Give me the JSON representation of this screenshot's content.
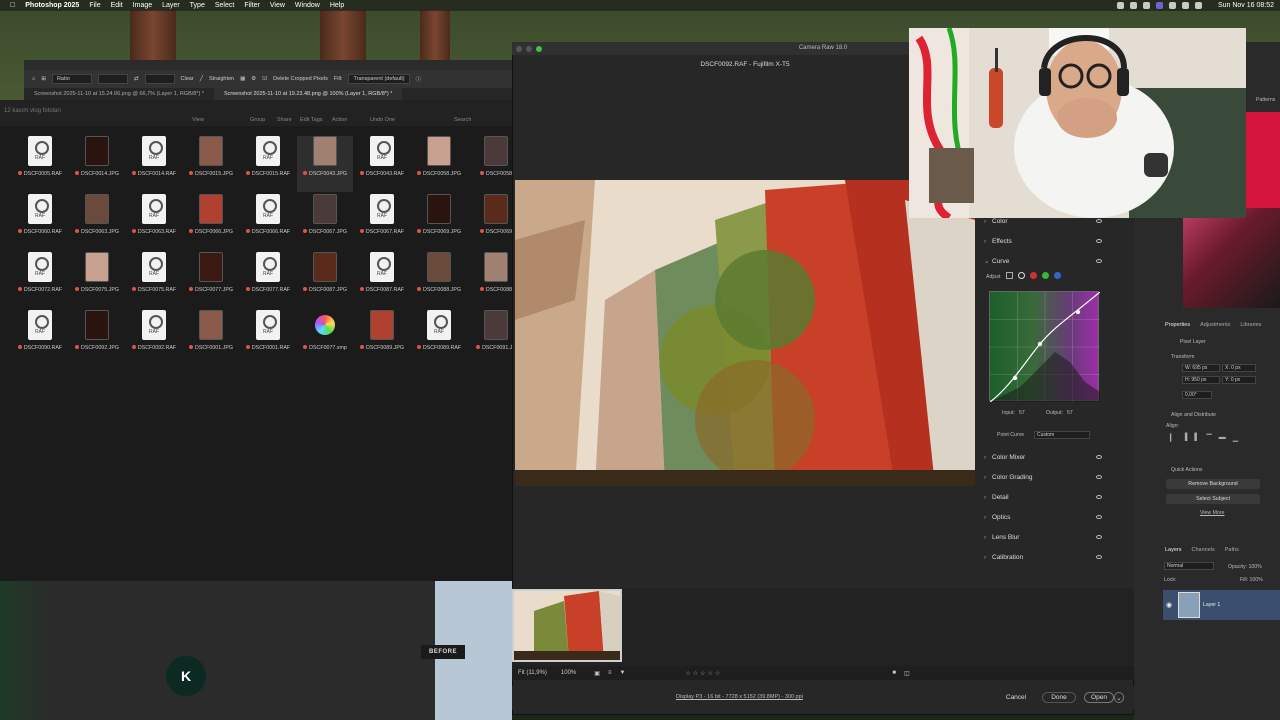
{
  "menubar": {
    "app": "Photoshop 2025",
    "items": [
      "File",
      "Edit",
      "Image",
      "Layer",
      "Type",
      "Select",
      "Filter",
      "View",
      "Window",
      "Help"
    ],
    "clock": "Sun Nov 16  08:52"
  },
  "ps_options": {
    "ratio": "Ratio",
    "clear": "Clear",
    "straighten": "Straighten",
    "delete_cropped": "Delete Cropped Pixels",
    "fill_label": "Fill:",
    "fill_value": "Transparent (default)"
  },
  "ps_tabs": [
    "Screenshot 2025-11-10 at 15.24.06.png @ 66,7% (Layer 1, RGB/8*) *",
    "Screenshot 2025-11-10 at 19.23.48.png @ 100% (Layer 1, RGB/8*) *"
  ],
  "bridge": {
    "folder": "12 kasım vlog fotoları",
    "toolbar": [
      "View",
      "Group",
      "Share",
      "Edit Tags",
      "Action",
      "Undo One",
      "Search"
    ],
    "rows": [
      [
        "DSCF0005.RAF",
        "DSCF0014.JPG",
        "DSCF0014.RAF",
        "DSCF0015.JPG",
        "DSCF0015.RAF",
        "DSCF0043.JPG",
        "DSCF0043.RAF",
        "DSCF0058.JPG",
        "DSCF0058"
      ],
      [
        "DSCF0060.RAF",
        "DSCF0063.JPG",
        "DSCF0063.RAF",
        "DSCF0066.JPG",
        "DSCF0066.RAF",
        "DSCF0067.JPG",
        "DSCF0067.RAF",
        "DSCF0069.JPG",
        "DSCF0069"
      ],
      [
        "DSCF0072.RAF",
        "DSCF0075.JPG",
        "DSCF0075.RAF",
        "DSCF0077.JPG",
        "DSCF0077.RAF",
        "DSCF0087.JPG",
        "DSCF0087.RAF",
        "DSCF0088.JPG",
        "DSCF0088"
      ],
      [
        "DSCF0090.RAF",
        "DSCF0092.JPG",
        "DSCF0092.RAF",
        "DSCF0001.JPG",
        "DSCF0001.RAF",
        "DSCF0077.xmp",
        "DSCF0089.JPG",
        "DSCF0089.RAF",
        "DSCF0091.JP"
      ]
    ],
    "raf_label": "RAF"
  },
  "before_label": "BEFORE",
  "badge_letter": "K",
  "camera_raw": {
    "title": "Camera Raw 18.0",
    "file": "DSCF0092.RAF  -  Fujifilm X-T5",
    "panel": {
      "color": "Color",
      "effects": "Effects",
      "curve": "Curve",
      "adjust": "Adjust",
      "input_label": "Input:",
      "input_value": "57",
      "output_label": "Output:",
      "output_value": "57",
      "point_curve_label": "Point Curve",
      "point_curve_value": "Custom",
      "sections": [
        "Color Mixer",
        "Color Grading",
        "Detail",
        "Optics",
        "Lens Blur",
        "Calibration"
      ]
    },
    "status": {
      "fit": "Fit (11,9%)",
      "zoom": "100%",
      "info": "Display P3 - 16 bit - 7728 x 5152 (39.8MP) - 300 ppi"
    },
    "buttons": {
      "cancel": "Cancel",
      "done": "Done",
      "open": "Open"
    }
  },
  "right_panel": {
    "patterns": "Patterns",
    "tabs": [
      "Properties",
      "Adjustments",
      "Libraries"
    ],
    "pixel_layer": "Pixel Layer",
    "transform": "Transform",
    "w": "W: 695 px",
    "h": "H: 950 px",
    "x": "X: 0 px",
    "y": "Y: 0 px",
    "angle": "0,00°",
    "align": "Align and Distribute",
    "align_sub": "Align:",
    "quick_actions": "Quick Actions",
    "remove_bg": "Remove Background",
    "select_subject": "Select Subject",
    "view_more": "View More",
    "layer_tabs": [
      "Layers",
      "Channels",
      "Paths"
    ],
    "blend": "Normal",
    "opacity": "Opacity: 100%",
    "lock": "Lock:",
    "fill": "Fill: 100%",
    "layer_name": "Layer 1"
  }
}
